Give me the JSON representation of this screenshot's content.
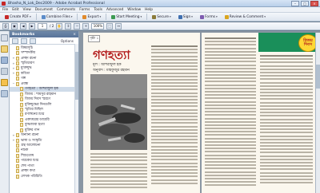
{
  "window": {
    "title": "Bhasha_N_Lok_Dec2009 - Adobe Acrobat Professional",
    "buttons": {
      "minimize": "–",
      "maximize": "□",
      "close": "×"
    }
  },
  "menu": {
    "items": [
      "File",
      "Edit",
      "View",
      "Document",
      "Comments",
      "Forms",
      "Tools",
      "Advanced",
      "Window",
      "Help"
    ]
  },
  "toolbar": {
    "create_pdf": "Create PDF",
    "combine_files": "Combine Files",
    "export": "Export",
    "start_meeting": "Start Meeting",
    "secure": "Secure",
    "sign": "Sign",
    "forms": "Forms",
    "review_comment": "Review & Comment"
  },
  "nav": {
    "page_value": "1",
    "page_total": "/ 2",
    "zoom": "100%",
    "options_label": "Options"
  },
  "bookmarks": {
    "header": "Bookmarks",
    "close": "×",
    "options": "Options",
    "items": [
      {
        "label": "বিষয়সূচি",
        "level": 0,
        "toggle": "",
        "selected": false
      },
      {
        "label": "সম্পাদকীয়",
        "level": 0,
        "toggle": "",
        "selected": false
      },
      {
        "label": "প্রচ্ছদ রচনা",
        "level": 0,
        "toggle": "+",
        "selected": false
      },
      {
        "label": "স্মৃতিচারণ",
        "level": 0,
        "toggle": "+",
        "selected": false
      },
      {
        "label": "মুক্তিযুদ্ধ",
        "level": 0,
        "toggle": "+",
        "selected": false
      },
      {
        "label": "কবিতা",
        "level": 0,
        "toggle": "+",
        "selected": false
      },
      {
        "label": "গল্প",
        "level": 0,
        "toggle": "",
        "selected": false
      },
      {
        "label": "প্রবন্ধ",
        "level": 0,
        "toggle": "−",
        "selected": false
      },
      {
        "label": "গণহত্যা : আশরাফুল হক",
        "level": 1,
        "toggle": "",
        "selected": true
      },
      {
        "label": "বিজয় : শামসুর রাহমান",
        "level": 1,
        "toggle": "",
        "selected": false
      },
      {
        "label": "বিজয় দিবস স্মরণে",
        "level": 1,
        "toggle": "",
        "selected": false
      },
      {
        "label": "মুক্তিযুদ্ধের দিনগুলি",
        "level": 1,
        "toggle": "",
        "selected": false
      },
      {
        "label": "স্মৃতির মিছিল",
        "level": 1,
        "toggle": "",
        "selected": false
      },
      {
        "label": "রণাঙ্গনের চিঠি",
        "level": 1,
        "toggle": "",
        "selected": false
      },
      {
        "label": "একাত্তরের ডায়েরি",
        "level": 1,
        "toggle": "",
        "selected": false
      },
      {
        "label": "বুদ্ধিজীবী হত্যা",
        "level": 1,
        "toggle": "",
        "selected": false
      },
      {
        "label": "মুক্তির গান",
        "level": 1,
        "toggle": "",
        "selected": false
      },
      {
        "label": "অন্যান্য রচনা",
        "level": 0,
        "toggle": "+",
        "selected": false
      },
      {
        "label": "ভাষা ও সংস্কৃতি",
        "level": 0,
        "toggle": "+",
        "selected": false
      },
      {
        "label": "গ্রন্থ আলোচনা",
        "level": 0,
        "toggle": "",
        "selected": false
      },
      {
        "label": "নাটক",
        "level": 0,
        "toggle": "",
        "selected": false
      },
      {
        "label": "শিশুতোষ",
        "level": 0,
        "toggle": "",
        "selected": false
      },
      {
        "label": "পাঠকের চিঠি",
        "level": 0,
        "toggle": "",
        "selected": false
      },
      {
        "label": "শেষ পাতা",
        "level": 0,
        "toggle": "",
        "selected": false
      },
      {
        "label": "প্রচ্ছদ কথা",
        "level": 0,
        "toggle": "",
        "selected": false
      },
      {
        "label": "লেখক পরিচিতি",
        "level": 0,
        "toggle": "",
        "selected": false
      }
    ]
  },
  "document": {
    "page_label": "পৃষ্ঠা ১",
    "story_title": "গণহত্যা",
    "byline": "মূল : আশরাফুল হক",
    "translator": "অনুবাদ : মাহফুজুর রহমান",
    "logo_text": "বিজয় দিবস"
  },
  "colors": {
    "accent_red": "#b31b1b",
    "banner_green": "#1a8f5a"
  }
}
